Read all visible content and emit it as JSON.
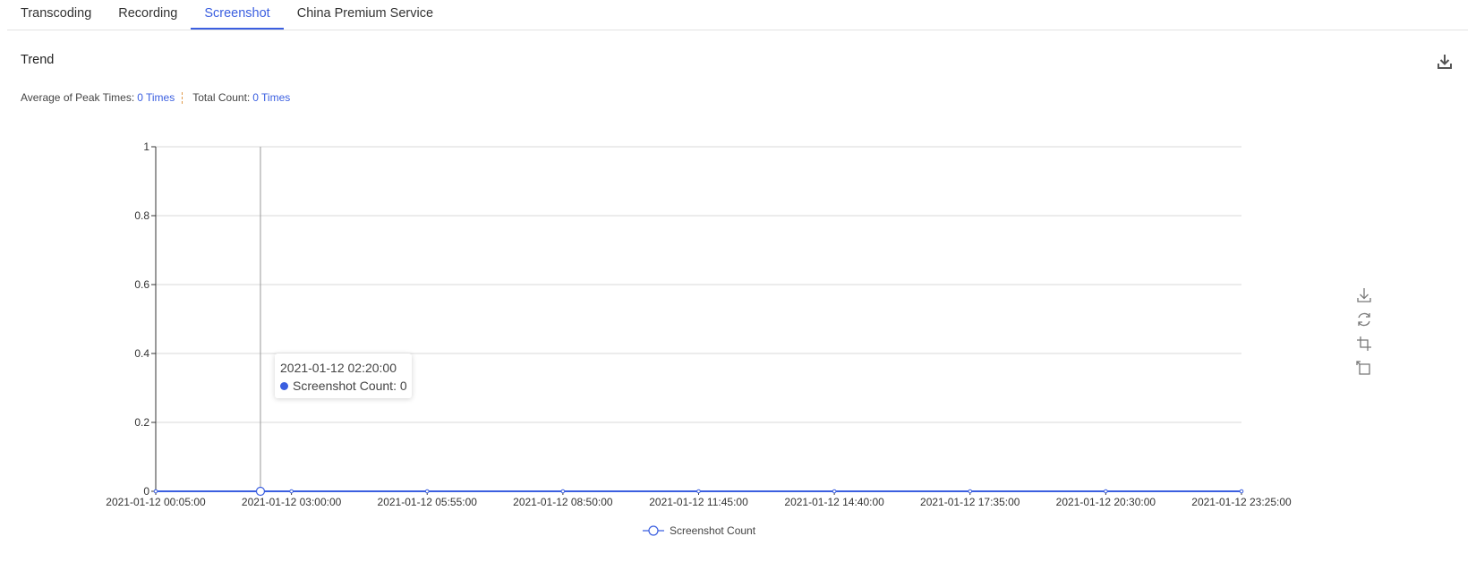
{
  "tabs": [
    {
      "label": "Transcoding",
      "active": false
    },
    {
      "label": "Recording",
      "active": false
    },
    {
      "label": "Screenshot",
      "active": true
    },
    {
      "label": "China Premium Service",
      "active": false
    }
  ],
  "section": {
    "title": "Trend",
    "download_icon": "download-icon"
  },
  "stats": {
    "avg_label": "Average of Peak Times:",
    "avg_value": "0 Times",
    "total_label": "Total Count:",
    "total_value": "0 Times"
  },
  "tooltip": {
    "time": "2021-01-12 02:20:00",
    "series_label": "Screenshot Count: 0"
  },
  "toolbox": [
    "save-image-icon",
    "restore-icon",
    "zoom-icon",
    "zoom-reset-icon"
  ],
  "colors": {
    "accent": "#3b5fe0",
    "grid": "#d9d9d9",
    "axis": "#333333"
  },
  "chart_data": {
    "type": "line",
    "xlabel": "",
    "ylabel": "",
    "ylim": [
      0,
      1
    ],
    "y_ticks": [
      "0",
      "0.2",
      "0.4",
      "0.6",
      "0.8",
      "1"
    ],
    "x_range": [
      "2021-01-12 00:05:00",
      "2021-01-12 23:25:00"
    ],
    "x_ticks": [
      "2021-01-12 00:05:00",
      "2021-01-12 03:00:00",
      "2021-01-12 05:55:00",
      "2021-01-12 08:50:00",
      "2021-01-12 11:45:00",
      "2021-01-12 14:40:00",
      "2021-01-12 17:35:00",
      "2021-01-12 20:30:00",
      "2021-01-12 23:25:00"
    ],
    "series": [
      {
        "name": "Screenshot Count",
        "color": "#3b5fe0",
        "points": [
          {
            "x": "2021-01-12 00:05:00",
            "y": 0
          },
          {
            "x": "2021-01-12 02:20:00",
            "y": 0
          },
          {
            "x": "2021-01-12 03:00:00",
            "y": 0
          },
          {
            "x": "2021-01-12 05:55:00",
            "y": 0
          },
          {
            "x": "2021-01-12 08:50:00",
            "y": 0
          },
          {
            "x": "2021-01-12 11:45:00",
            "y": 0
          },
          {
            "x": "2021-01-12 14:40:00",
            "y": 0
          },
          {
            "x": "2021-01-12 17:35:00",
            "y": 0
          },
          {
            "x": "2021-01-12 20:30:00",
            "y": 0
          },
          {
            "x": "2021-01-12 23:25:00",
            "y": 0
          }
        ]
      }
    ],
    "highlighted_x": "2021-01-12 02:20:00",
    "grid": true,
    "legend_position": "bottom-center"
  }
}
